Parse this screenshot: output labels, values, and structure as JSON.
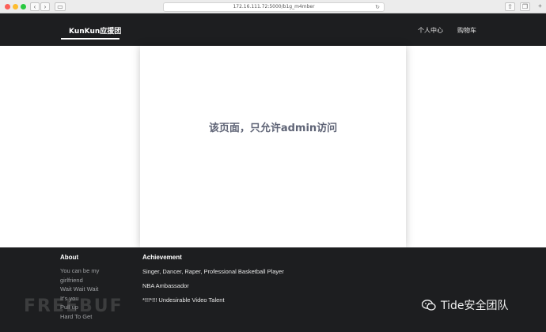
{
  "browser": {
    "url": "172.16.111.72:5000/b1g_m4mber",
    "back_icon": "chevron-left-icon",
    "forward_icon": "chevron-right-icon"
  },
  "header": {
    "brand": "KunKun应援团",
    "nav": [
      "个人中心",
      "购物车"
    ]
  },
  "main": {
    "message": "该页面，只允许admin访问"
  },
  "footer": {
    "about_heading": "About",
    "about_links": [
      "You can be my girlfriend",
      "Wait Wait Wait",
      "It's you",
      "Pull up",
      "Hard To Get"
    ],
    "achievement_heading": "Achievement",
    "achievements": [
      "Singer, Dancer, Raper, Professional Basketball Player",
      "NBA Ambassador",
      "*!!!*!!! Undesirable Video Talent"
    ]
  },
  "watermarks": {
    "left": "FREEBUF",
    "right": "Tide安全团队"
  }
}
